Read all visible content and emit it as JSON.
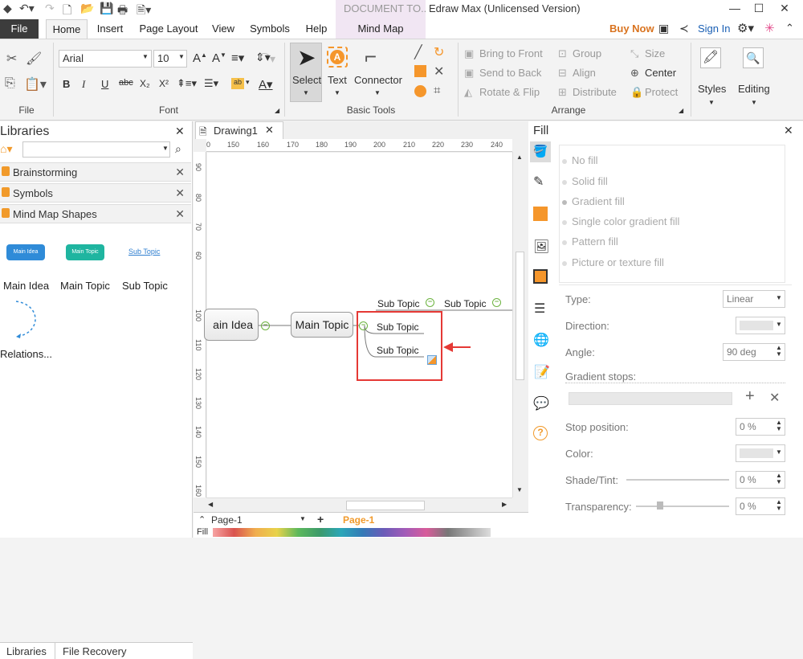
{
  "title": {
    "context_tab": "DOCUMENT TO...",
    "window_title": "Edraw Max (Unlicensed Version)"
  },
  "menu": {
    "tabs": [
      "File",
      "Home",
      "Insert",
      "Page Layout",
      "View",
      "Symbols",
      "Help",
      "Mind Map"
    ],
    "buy_now": "Buy Now",
    "sign_in": "Sign In"
  },
  "ribbon": {
    "font_name": "Arial",
    "font_size": "10",
    "groups": {
      "file": "File",
      "font": "Font",
      "basic_tools": "Basic Tools",
      "arrange": "Arrange"
    },
    "tools": {
      "select": "Select",
      "text": "Text",
      "connector": "Connector"
    },
    "arrange": {
      "bring_front": "Bring to Front",
      "send_back": "Send to Back",
      "rotate_flip": "Rotate & Flip",
      "group": "Group",
      "align": "Align",
      "distribute": "Distribute",
      "size": "Size",
      "center": "Center",
      "protect": "Protect"
    },
    "styles": "Styles",
    "editing": "Editing"
  },
  "libraries": {
    "title": "Libraries",
    "items": [
      "Brainstorming",
      "Symbols",
      "Mind Map Shapes"
    ],
    "shape_pills": [
      "Main Idea",
      "Main Topic",
      "Sub Topic"
    ],
    "shape_labels": [
      "Main Idea",
      "Main Topic",
      "Sub Topic",
      "Relations..."
    ]
  },
  "document": {
    "tab_name": "Drawing1",
    "ruler_top": [
      "0",
      "150",
      "160",
      "170",
      "180",
      "190",
      "200",
      "210",
      "220",
      "230",
      "240"
    ],
    "ruler_left": [
      "90",
      "80",
      "70",
      "60",
      "100",
      "110",
      "120",
      "130",
      "140",
      "150",
      "160"
    ],
    "nodes": {
      "main_idea": "ain Idea",
      "main_topic": "Main Topic",
      "sub1": "Sub Topic",
      "sub2": "Sub Topic",
      "top_sub1": "Sub Topic",
      "top_sub2": "Sub Topic"
    }
  },
  "pagebar": {
    "page_select": "Page-1",
    "page_tab": "Page-1",
    "fill_label": "Fill"
  },
  "fill_panel": {
    "title": "Fill",
    "options": [
      "No fill",
      "Solid fill",
      "Gradient fill",
      "Single color gradient fill",
      "Pattern fill",
      "Picture or texture fill"
    ],
    "type_label": "Type:",
    "type_value": "Linear",
    "direction_label": "Direction:",
    "angle_label": "Angle:",
    "angle_value": "90 deg",
    "stops_label": "Gradient stops:",
    "stop_pos_label": "Stop position:",
    "stop_pos_value": "0 %",
    "color_label": "Color:",
    "shade_label": "Shade/Tint:",
    "shade_value": "0 %",
    "transparency_label": "Transparency:",
    "transparency_value": "0 %"
  },
  "bottom_tabs": [
    "Libraries",
    "File Recovery"
  ],
  "colors": {
    "accent": "#e24b4b",
    "buy": "#d9731f",
    "sign_in": "#1a5fb4",
    "main_idea_pill": "#2f8bd8",
    "main_topic_pill": "#1fb5a0",
    "orange": "#f5962b",
    "highlight_box": "#e53935"
  }
}
